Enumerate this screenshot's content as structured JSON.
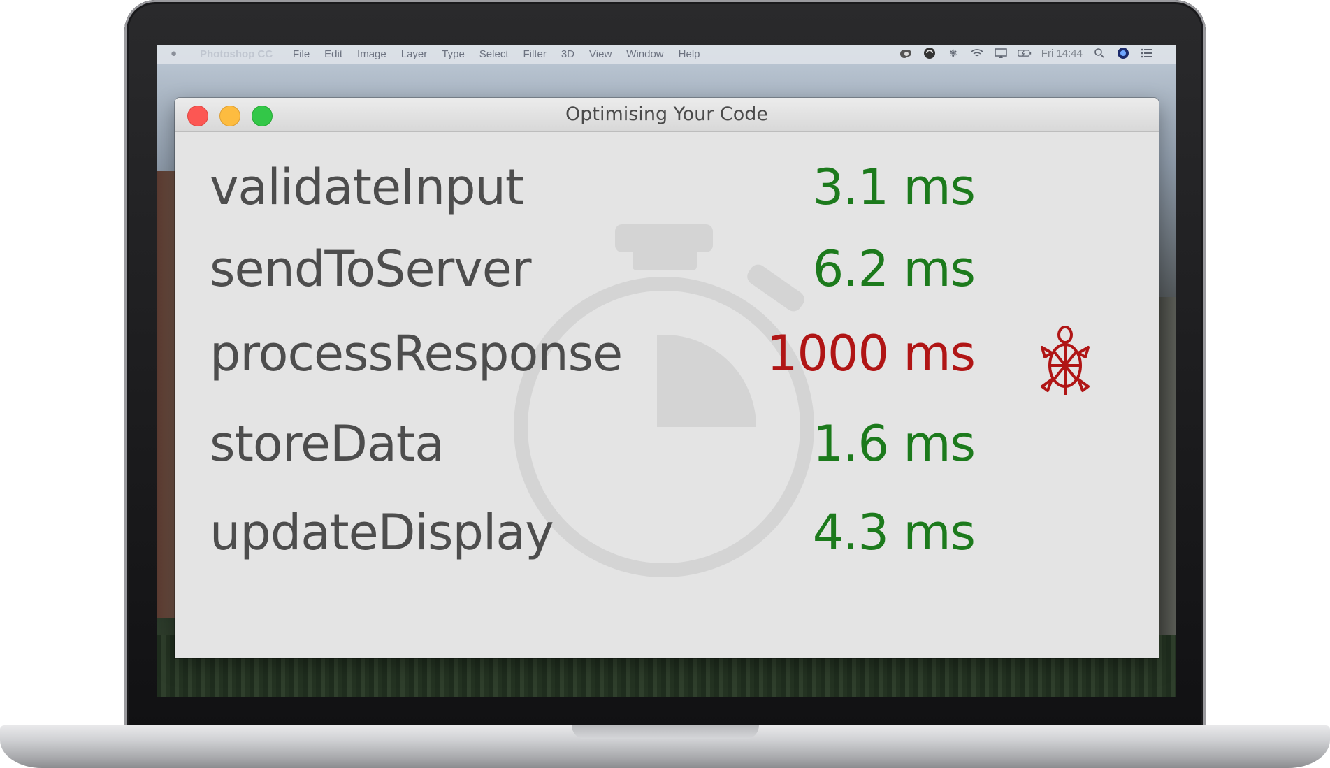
{
  "menubar": {
    "app_name": "Photoshop CC",
    "menus": [
      "File",
      "Edit",
      "Image",
      "Layer",
      "Type",
      "Select",
      "Filter",
      "3D",
      "View",
      "Window",
      "Help"
    ],
    "clock": "Fri 14:44",
    "status_icons": [
      "creative-cloud-icon",
      "sync-icon",
      "bluetooth-icon",
      "wifi-icon",
      "airplay-icon",
      "battery-icon",
      "spotlight-search-icon",
      "siri-icon",
      "notification-center-icon"
    ]
  },
  "window": {
    "title": "Optimising Your Code"
  },
  "colors": {
    "fast": "#1c7a1c",
    "slow": "#b01515",
    "function_text": "#4d4d4d",
    "stopwatch": "#d0d0d0"
  },
  "functions": [
    {
      "name": "validateInput",
      "time": "3.1 ms",
      "status": "fast"
    },
    {
      "name": "sendToServer",
      "time": "6.2 ms",
      "status": "fast"
    },
    {
      "name": "processResponse",
      "time": "1000 ms",
      "status": "slow",
      "icon": "turtle-icon"
    },
    {
      "name": "storeData",
      "time": "1.6 ms",
      "status": "fast"
    },
    {
      "name": "updateDisplay",
      "time": "4.3 ms",
      "status": "fast"
    }
  ],
  "background_icon": "stopwatch-icon"
}
